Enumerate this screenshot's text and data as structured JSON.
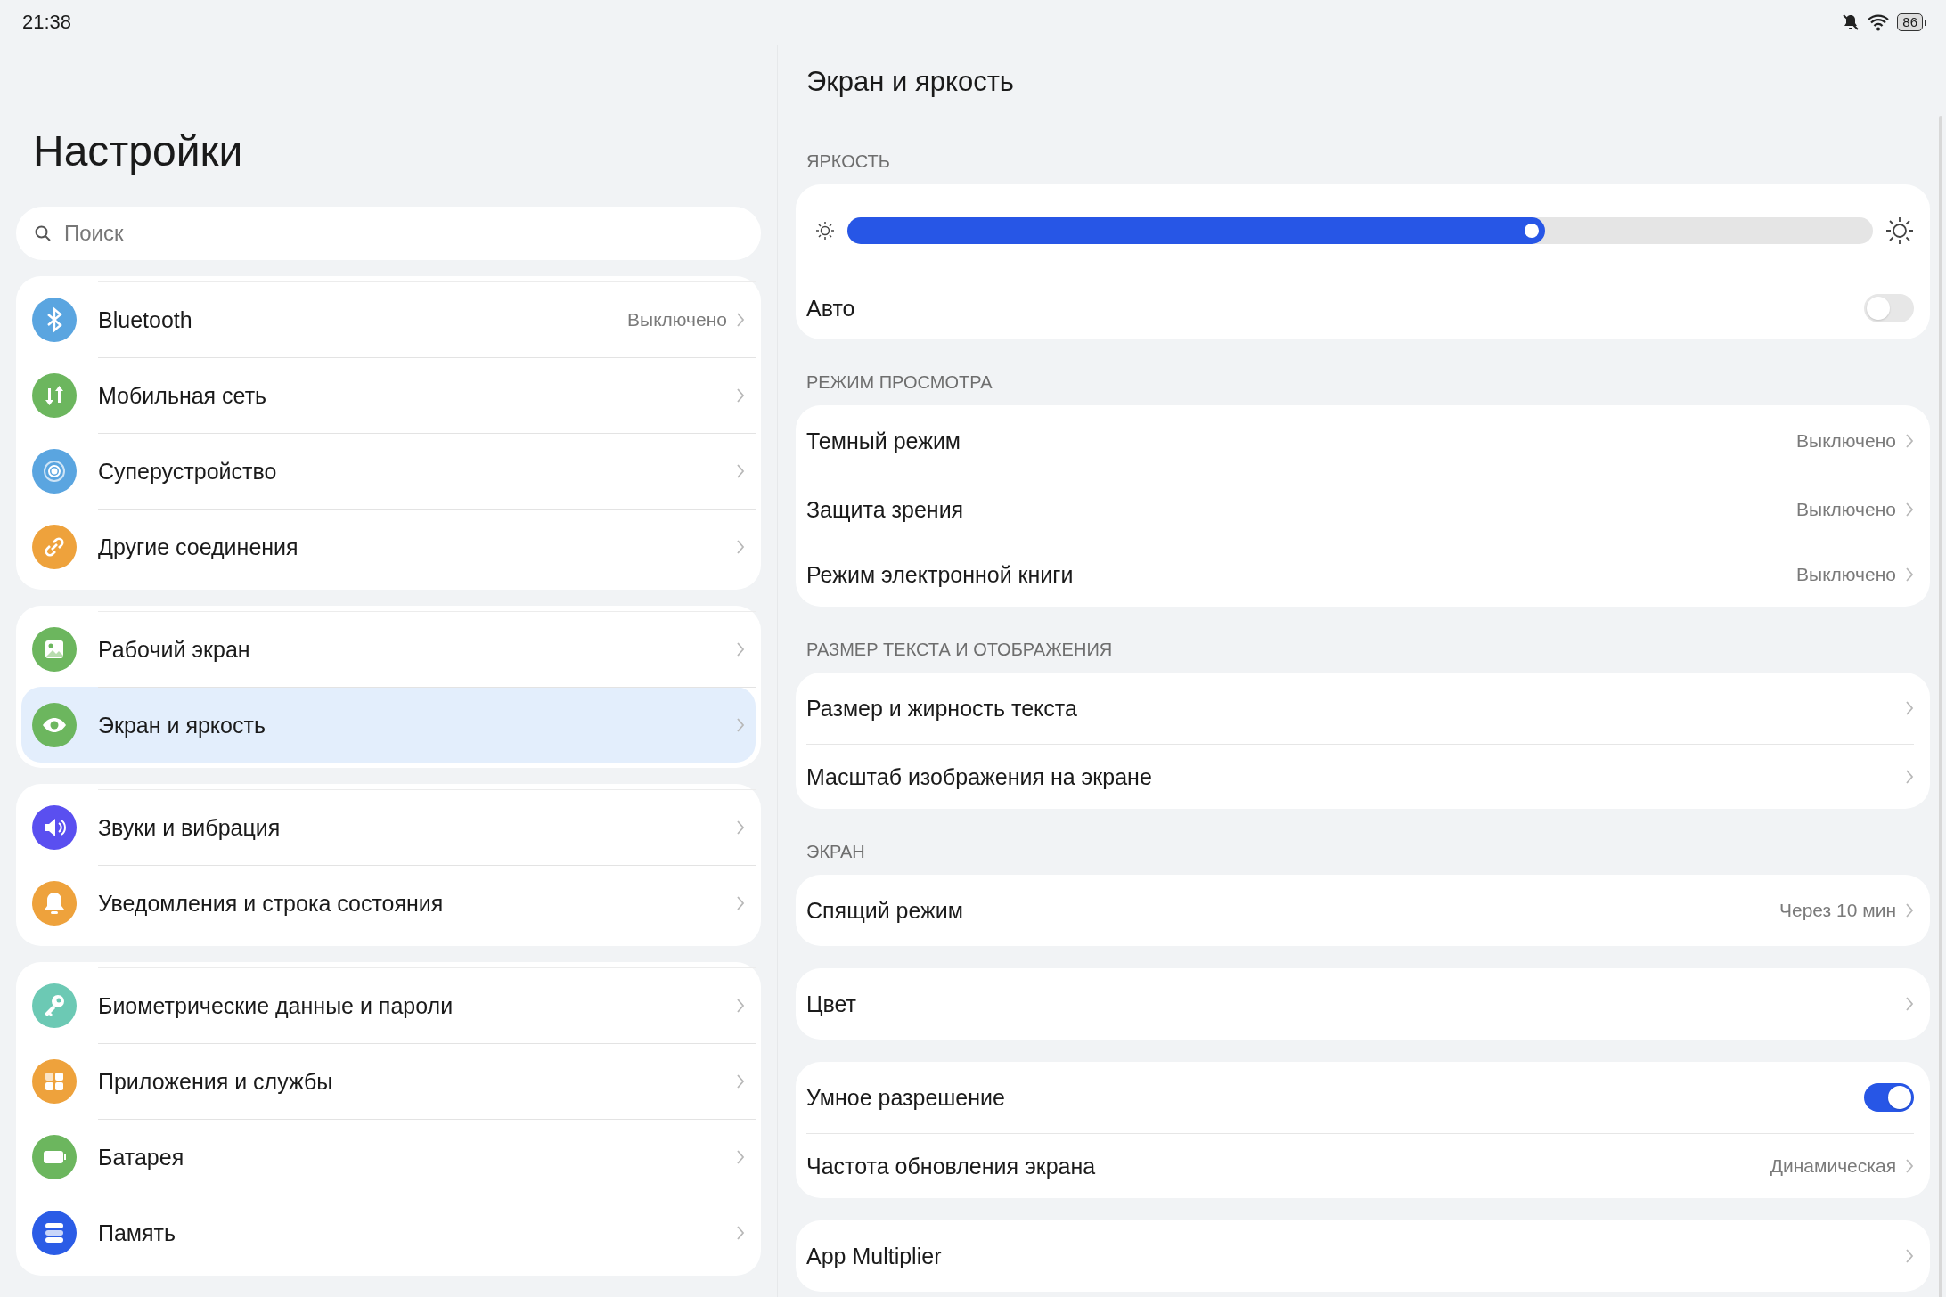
{
  "status_bar": {
    "time": "21:38",
    "battery": "86"
  },
  "sidebar": {
    "title": "Настройки",
    "search": {
      "placeholder": "Поиск"
    },
    "groups": [
      {
        "items": [
          {
            "label": "Bluetooth",
            "value": "Выключено",
            "color": "#5aa5e0",
            "selected": false
          },
          {
            "label": "Мобильная сеть",
            "color": "#6cb65e",
            "selected": false
          },
          {
            "label": "Суперустройство",
            "color": "#5aa5e0",
            "selected": false
          },
          {
            "label": "Другие соединения",
            "color": "#eea23c",
            "selected": false
          }
        ]
      },
      {
        "items": [
          {
            "label": "Рабочий экран",
            "color": "#6cb65e",
            "selected": false
          },
          {
            "label": "Экран и яркость",
            "color": "#6cb65e",
            "selected": true
          }
        ]
      },
      {
        "items": [
          {
            "label": "Звуки и вибрация",
            "color": "#5a4ff0",
            "selected": false
          },
          {
            "label": "Уведомления и строка состояния",
            "color": "#eea23c",
            "selected": false
          }
        ]
      },
      {
        "items": [
          {
            "label": "Биометрические данные и пароли",
            "color": "#6cc9b4",
            "selected": false
          },
          {
            "label": "Приложения и службы",
            "color": "#eea23c",
            "selected": false
          },
          {
            "label": "Батарея",
            "color": "#6cb65e",
            "selected": false
          },
          {
            "label": "Память",
            "color": "#2b5ce6",
            "selected": false
          }
        ]
      }
    ]
  },
  "panel": {
    "title": "Экран и яркость",
    "sections": [
      {
        "header": "ЯРКОСТЬ",
        "rows": [
          {
            "kind": "slider",
            "level": 0.68
          },
          {
            "kind": "toggle",
            "label": "Авто",
            "on": false
          }
        ]
      },
      {
        "header": "РЕЖИМ ПРОСМОТРА",
        "rows": [
          {
            "kind": "link",
            "label": "Темный режим",
            "value": "Выключено"
          },
          {
            "kind": "link",
            "label": "Защита зрения",
            "value": "Выключено"
          },
          {
            "kind": "link",
            "label": "Режим электронной книги",
            "value": "Выключено"
          }
        ]
      },
      {
        "header": "РАЗМЕР ТЕКСТА И ОТОБРАЖЕНИЯ",
        "rows": [
          {
            "kind": "link",
            "label": "Размер и жирность текста"
          },
          {
            "kind": "link",
            "label": "Масштаб изображения на экране"
          }
        ]
      },
      {
        "header": "ЭКРАН",
        "rows": [
          {
            "kind": "link",
            "label": "Спящий режим",
            "value": "Через 10 мин"
          }
        ]
      },
      {
        "rows": [
          {
            "kind": "link",
            "label": "Цвет"
          }
        ]
      },
      {
        "rows": [
          {
            "kind": "toggle",
            "label": "Умное разрешение",
            "on": true
          },
          {
            "kind": "link",
            "label": "Частота обновления экрана",
            "value": "Динамическая"
          }
        ]
      },
      {
        "rows": [
          {
            "kind": "link",
            "label": "App Multiplier"
          }
        ]
      }
    ]
  }
}
